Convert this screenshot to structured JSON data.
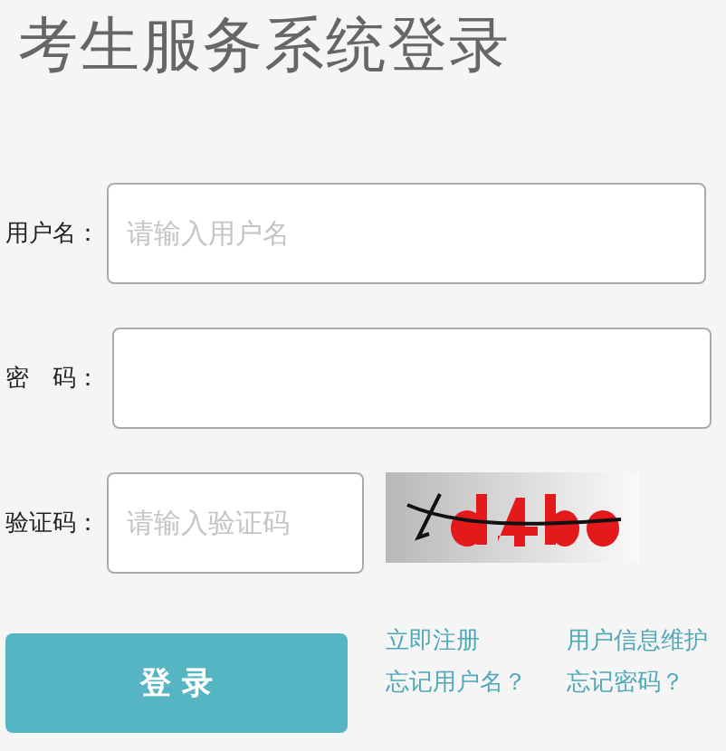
{
  "title": "考生服务系统登录",
  "fields": [
    {
      "label": "用户名：",
      "placeholder": "请输入用户名",
      "kind": "text"
    },
    {
      "label": "密　码：",
      "kind": "password"
    },
    {
      "label": "验证码：",
      "placeholder": "请输入验证码",
      "kind": "captcha"
    }
  ],
  "login_button": "登 录",
  "links": [
    "立即注册",
    "用户信息维护",
    "忘记用户名？",
    "忘记密码？"
  ]
}
